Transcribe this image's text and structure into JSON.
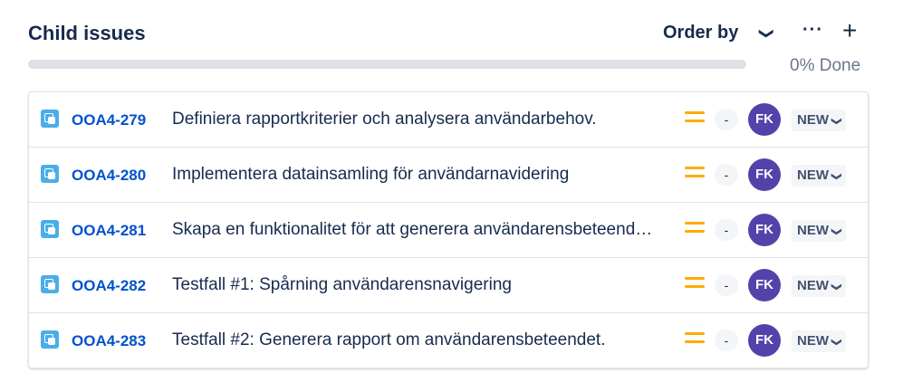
{
  "header": {
    "title": "Child issues",
    "order_by": "Order by",
    "done": "0% Done"
  },
  "progress": {
    "percent": 0
  },
  "colors": {
    "key": "#0052cc",
    "priority": "#ffab00",
    "avatar": "#5243aa",
    "icon": "#4bade8"
  },
  "issues": [
    {
      "key": "OOA4-279",
      "summary": "Definiera rapportkriterier och analysera användarbehov.",
      "estimate": "-",
      "assignee": "FK",
      "status": "NEW"
    },
    {
      "key": "OOA4-280",
      "summary": "Implementera datainsamling för användarnavidering",
      "estimate": "-",
      "assignee": "FK",
      "status": "NEW"
    },
    {
      "key": "OOA4-281",
      "summary": "Skapa en funktionalitet för att generera användarensbeteenderapport",
      "estimate": "-",
      "assignee": "FK",
      "status": "NEW"
    },
    {
      "key": "OOA4-282",
      "summary": "Testfall #1: Spårning användarensnavigering",
      "estimate": "-",
      "assignee": "FK",
      "status": "NEW"
    },
    {
      "key": "OOA4-283",
      "summary": "Testfall #2: Generera rapport om användarensbeteendet.",
      "estimate": "-",
      "assignee": "FK",
      "status": "NEW"
    }
  ]
}
